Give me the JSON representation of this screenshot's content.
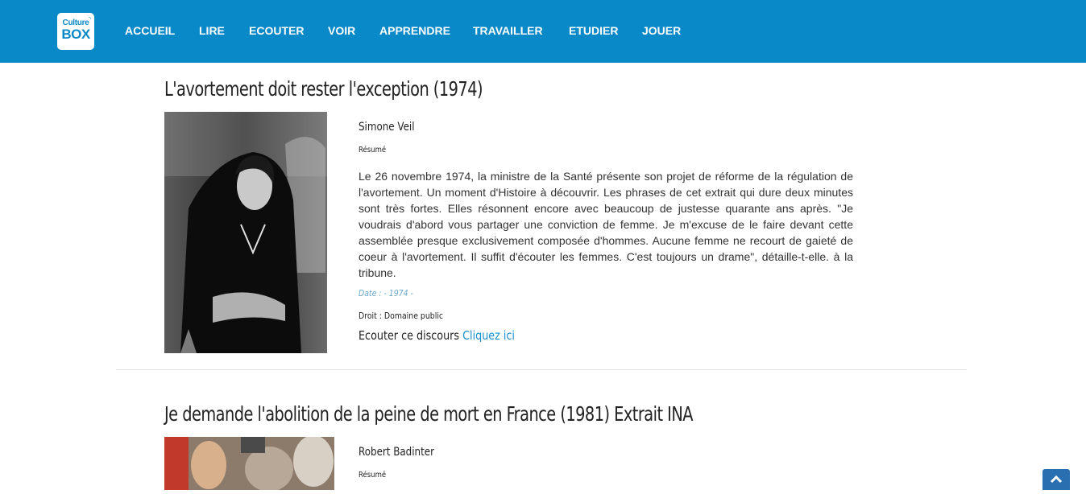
{
  "header": {
    "logo_line1": "Culture",
    "logo_line2": "BOX",
    "nav": [
      "ACCUEIL",
      "LIRE",
      "ECOUTER",
      "VOIR",
      "APPRENDRE",
      "TRAVAILLER",
      "ETUDIER",
      "JOUER"
    ]
  },
  "articles": [
    {
      "title": "L'avortement doit rester l'exception (1974)",
      "author": "Simone Veil",
      "resume_label": "Résumé",
      "summary": "Le 26 novembre 1974, la ministre de la Santé présente son projet de réforme de la régulation de l'avortement. Un moment d'Histoire à découvrir. Les phrases de cet extrait qui dure deux minutes sont très fortes. Elles résonnent encore avec beaucoup de justesse quarante ans après. \"Je voudrais d'abord vous partager une conviction de femme. Je m'excuse de le faire devant cette assemblée presque exclusivement composée d'hommes. Aucune femme ne recourt de gaieté de coeur à l'avortement. Il suffit d'écouter les femmes. C'est toujours un drame\", détaille-t-elle. à la tribune.",
      "date": "Date : - 1974 -",
      "droit": "Droit : Domaine public",
      "listen_label": "Ecouter ce discours",
      "listen_link": "Cliquez ici"
    },
    {
      "title": "Je demande l'abolition de la peine de mort en France (1981) Extrait INA",
      "author": "Robert Badinter",
      "resume_label": "Résumé"
    }
  ],
  "scroll_top_icon": "chevron-up-icon"
}
